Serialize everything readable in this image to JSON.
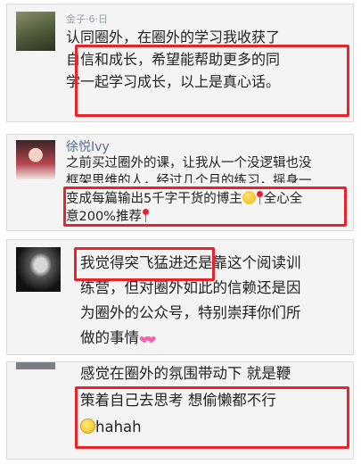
{
  "comments": [
    {
      "name": "金子·6·日",
      "lines": [
        "认同圈外，在圈外的学习我收获了",
        "自信和成长，希望能帮助更多的同",
        "学一起学习成长，以上是真心话。"
      ]
    },
    {
      "name": "徐悦Ivy",
      "lines": [
        "之前买过圈外的课，让我从一个没逻辑也没",
        "框架思维的人，经过几个月的练习，摇身一",
        "变成每篇输出5千字干货的博主",
        "全心全",
        "意200%推荐"
      ]
    },
    {
      "name": "",
      "lines": [
        "我觉得突飞猛进",
        "还是靠这个阅读训",
        "练营，但对圈外如此的信赖还是因",
        "为圈外的公众号，特别崇拜你们所",
        "做的事情"
      ]
    },
    {
      "name": "",
      "lines": [
        "感觉在圈外的氛围带动下 就是鞭",
        "策着自己去思考  想偷懒都不行",
        "hahah"
      ]
    }
  ],
  "colors": {
    "highlight": "#e8242b",
    "name": "#576b95",
    "text": "#222222",
    "card": "#f4f4f4"
  },
  "icons": [
    "avatar-landscape",
    "avatar-woman",
    "avatar-man-bw",
    "avatar-partial",
    "gold-coin-emoji",
    "rose-emoji",
    "hearts-emoji",
    "smile-emoji"
  ]
}
